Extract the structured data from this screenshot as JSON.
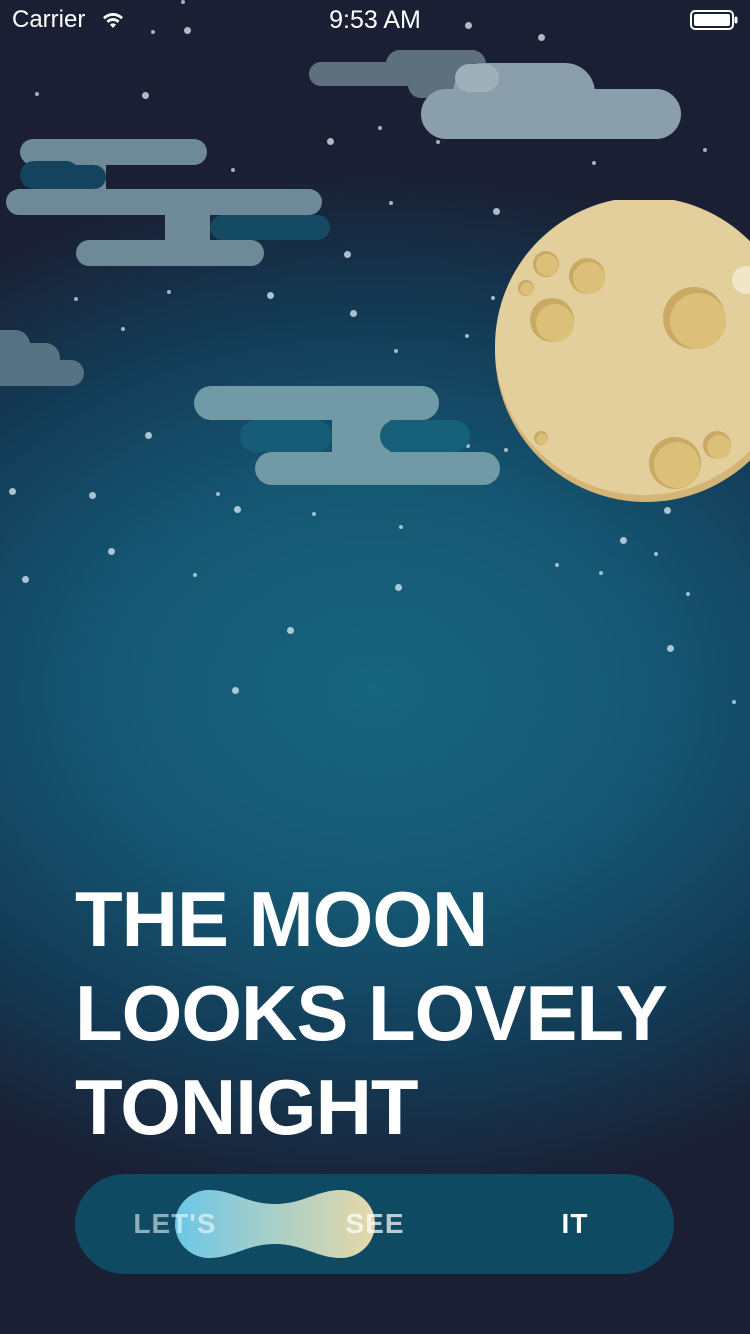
{
  "status_bar": {
    "carrier": "Carrier",
    "time": "9:53 AM",
    "wifi_icon": "wifi-icon",
    "battery_icon": "battery-icon"
  },
  "scene": {
    "moon_icon": "moon-icon",
    "cloud_icon": "cloud-icon",
    "colors": {
      "sky_center": "#176580",
      "sky_edge": "#1a1f33",
      "moon": "#e3cf9c",
      "moon_shadow": "#d4b577",
      "crater": "#dcc07a",
      "cloud_light": "#8b9eab",
      "cloud_teal": "#6f9aa6"
    }
  },
  "headline": {
    "line1": "THE MOON",
    "line2": "LOOKS LOVELY",
    "line3": "TONIGHT"
  },
  "segmented": {
    "options": [
      "LET'S",
      "SEE",
      "IT"
    ],
    "selected_index": 2,
    "colors": {
      "track": "#0f4a63",
      "blob_start": "#6cc6e6",
      "blob_end": "#e6d8a8"
    }
  }
}
